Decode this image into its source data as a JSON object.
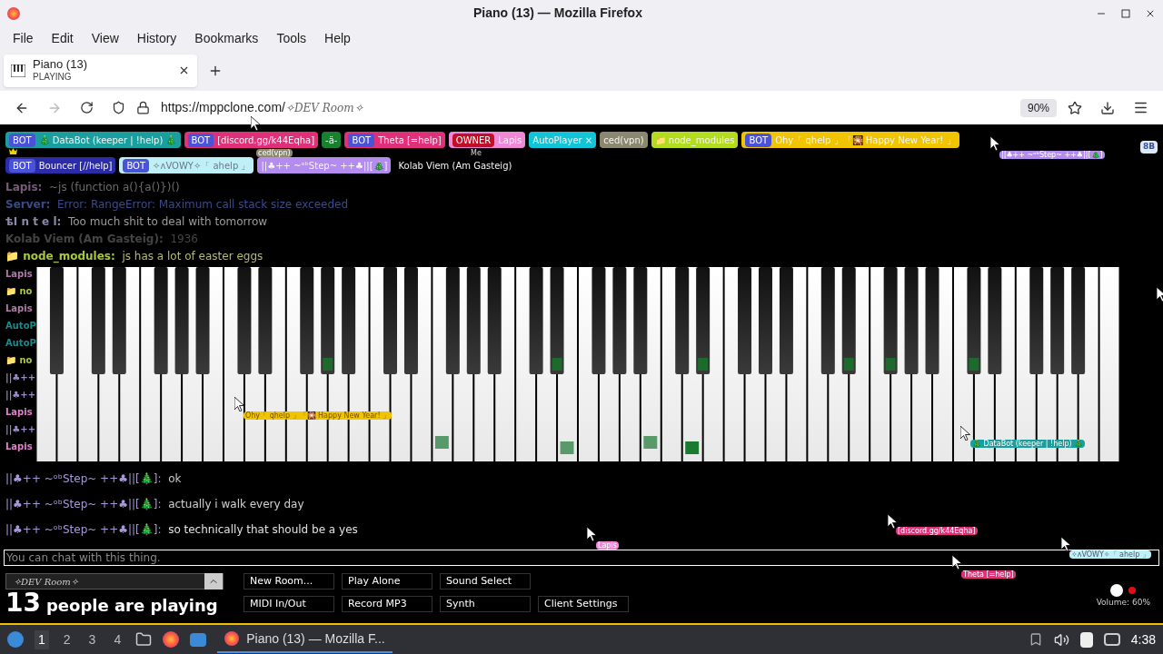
{
  "window": {
    "title": "Piano (13) — Mozilla Firefox"
  },
  "menu": [
    "File",
    "Edit",
    "View",
    "History",
    "Bookmarks",
    "Tools",
    "Help"
  ],
  "tabs": [
    {
      "title": "Piano (13)",
      "subtitle": "PLAYING",
      "selected": true
    }
  ],
  "address": {
    "url": "https://mppclone.com/",
    "url_rest": "✧DEV Room✧",
    "zoom": "90%"
  },
  "user_rows": [
    [
      {
        "name": "🎄 DataBot (keeper | !help) 🎄",
        "badge": {
          "label": "BOT",
          "kind": "bot"
        },
        "color": "#1a9e9e"
      },
      {
        "name": "[discord.gg/k44Eqha]",
        "badge": {
          "label": "BOT",
          "kind": "bot"
        },
        "color": "#e0307a"
      },
      {
        "name": "-ä-",
        "color": "#18802e"
      },
      {
        "name": "Theta [=help]",
        "badge": {
          "label": "BOT",
          "kind": "bot"
        },
        "color": "#e0307a"
      },
      {
        "name": "Lapis",
        "badge": {
          "label": "OWNER",
          "kind": "owner"
        },
        "color": "#f088d8"
      },
      {
        "name": "AutoPlayer ×",
        "color": "#12c4d8"
      },
      {
        "name": "ced(vpn)",
        "color": "#8c8870"
      },
      {
        "name": "📁 node_modules",
        "color": "#b4dc1e"
      },
      {
        "name": "Ohy「 qhelp 」「🎇 Happy New Year! 」",
        "badge": {
          "label": "BOT",
          "kind": "bot"
        },
        "color": "#f0c400"
      }
    ],
    [
      {
        "name": "Bouncer [//help]",
        "badge": {
          "label": "BOT",
          "kind": "bot"
        },
        "color": "#2c2ca8"
      },
      {
        "name": "✧ᴧVOWY✧「 ahelp 」",
        "badge": {
          "label": "BOT",
          "kind": "bot"
        },
        "color": "#bff0f8"
      },
      {
        "name": "||♣++ ~ᵒᵇStep~ ++♣||[🎄]",
        "color": "#b48cf0"
      },
      {
        "name": "Kolab Viem (Am Gasteig)",
        "color": "#000000"
      }
    ]
  ],
  "chat_top": [
    {
      "name": "Lapis:",
      "text": "~js (function a(){a()})()",
      "color": "#7a5a78"
    },
    {
      "name": "Server:",
      "text": "Error: RangeError: Maximum call stack size exceeded",
      "color": "#3a4a8a"
    },
    {
      "name": "ѣI n t e l:",
      "text": "Too much shit to deal with tomorrow",
      "color": "#8a8aa8"
    },
    {
      "name": "Kolab Viem (Am Gasteig):",
      "text": "1936",
      "color": "#444444"
    },
    {
      "name": "📁 node_modules:",
      "text": "js has a lot of easter eggs",
      "color": "#a8c83a"
    }
  ],
  "chat_side": [
    {
      "name": "Lapis",
      "color": "#b07aa8"
    },
    {
      "name": "📁 no",
      "color": "#a8c83a"
    },
    {
      "name": "Lapis",
      "color": "#b07aa8"
    },
    {
      "name": "AutoP",
      "color": "#1a8a8a"
    },
    {
      "name": "AutoP",
      "color": "#1a8a8a"
    },
    {
      "name": "📁 no",
      "color": "#a8c83a"
    },
    {
      "name": "||♣++",
      "color": "#9a8ac8"
    },
    {
      "name": "||♣++",
      "color": "#9a8ac8"
    },
    {
      "name": "Lapis",
      "color": "#e080c8"
    },
    {
      "name": "||♣++",
      "color": "#9a8ac8"
    },
    {
      "name": "Lapis",
      "color": "#e080c8"
    }
  ],
  "chat_bottom": [
    {
      "name": "||♣++ ~ᵒᵇStep~ ++♣||[🎄]:",
      "text": "ok",
      "color": "#a898d8"
    },
    {
      "name": "||♣++ ~ᵒᵇStep~ ++♣||[🎄]:",
      "text": "actually i walk every day",
      "color": "#a898d8"
    },
    {
      "name": "||♣++ ~ᵒᵇStep~ ++♣||[🎄]:",
      "text": "so technically that should be a yes",
      "color": "#a898d8"
    }
  ],
  "cursor_labels": [
    {
      "text": "ced(vpn)",
      "color": "#8c8870"
    },
    {
      "text": "Me",
      "color": "#000000"
    },
    {
      "text": "||♣++ ~ᵒᵇStep~ ++♣||[🎄]",
      "color": "#b48cf0"
    },
    {
      "text": "Ohy「 qhelp 」「🎇 Happy New Year! 」",
      "color": "#f0c400"
    },
    {
      "text": "🎄 DataBot (keeper | !help) 🎄",
      "color": "#1a9e9e"
    },
    {
      "text": "Lapis",
      "color": "#f088d8"
    },
    {
      "text": "[discord.gg/k44Eqha]",
      "color": "#e0307a"
    },
    {
      "text": "Theta [=help]",
      "color": "#e0307a"
    },
    {
      "text": "✧ᴧVOWY✧「 ahelp 」",
      "color": "#bff0f8"
    }
  ],
  "side_button": "8B",
  "chat_input": {
    "placeholder": "You can chat with this thing."
  },
  "room": {
    "name": "✧DEV Room✧"
  },
  "players": {
    "count": "13",
    "label": "people are playing"
  },
  "buttons": [
    "New Room...",
    "Play Alone",
    "Sound Select",
    "MIDI In/Out",
    "Record MP3",
    "Synth",
    "Client Settings"
  ],
  "volume": "Volume: 60%",
  "taskbar": {
    "workspaces": [
      {
        "label": "1",
        "selected": true
      },
      {
        "label": "2",
        "selected": false
      },
      {
        "label": "3",
        "selected": false
      },
      {
        "label": "4",
        "selected": false
      }
    ],
    "tasks": [
      {
        "title": "Piano (13) — Mozilla F...",
        "selected": true
      }
    ],
    "clock": "4:38"
  }
}
